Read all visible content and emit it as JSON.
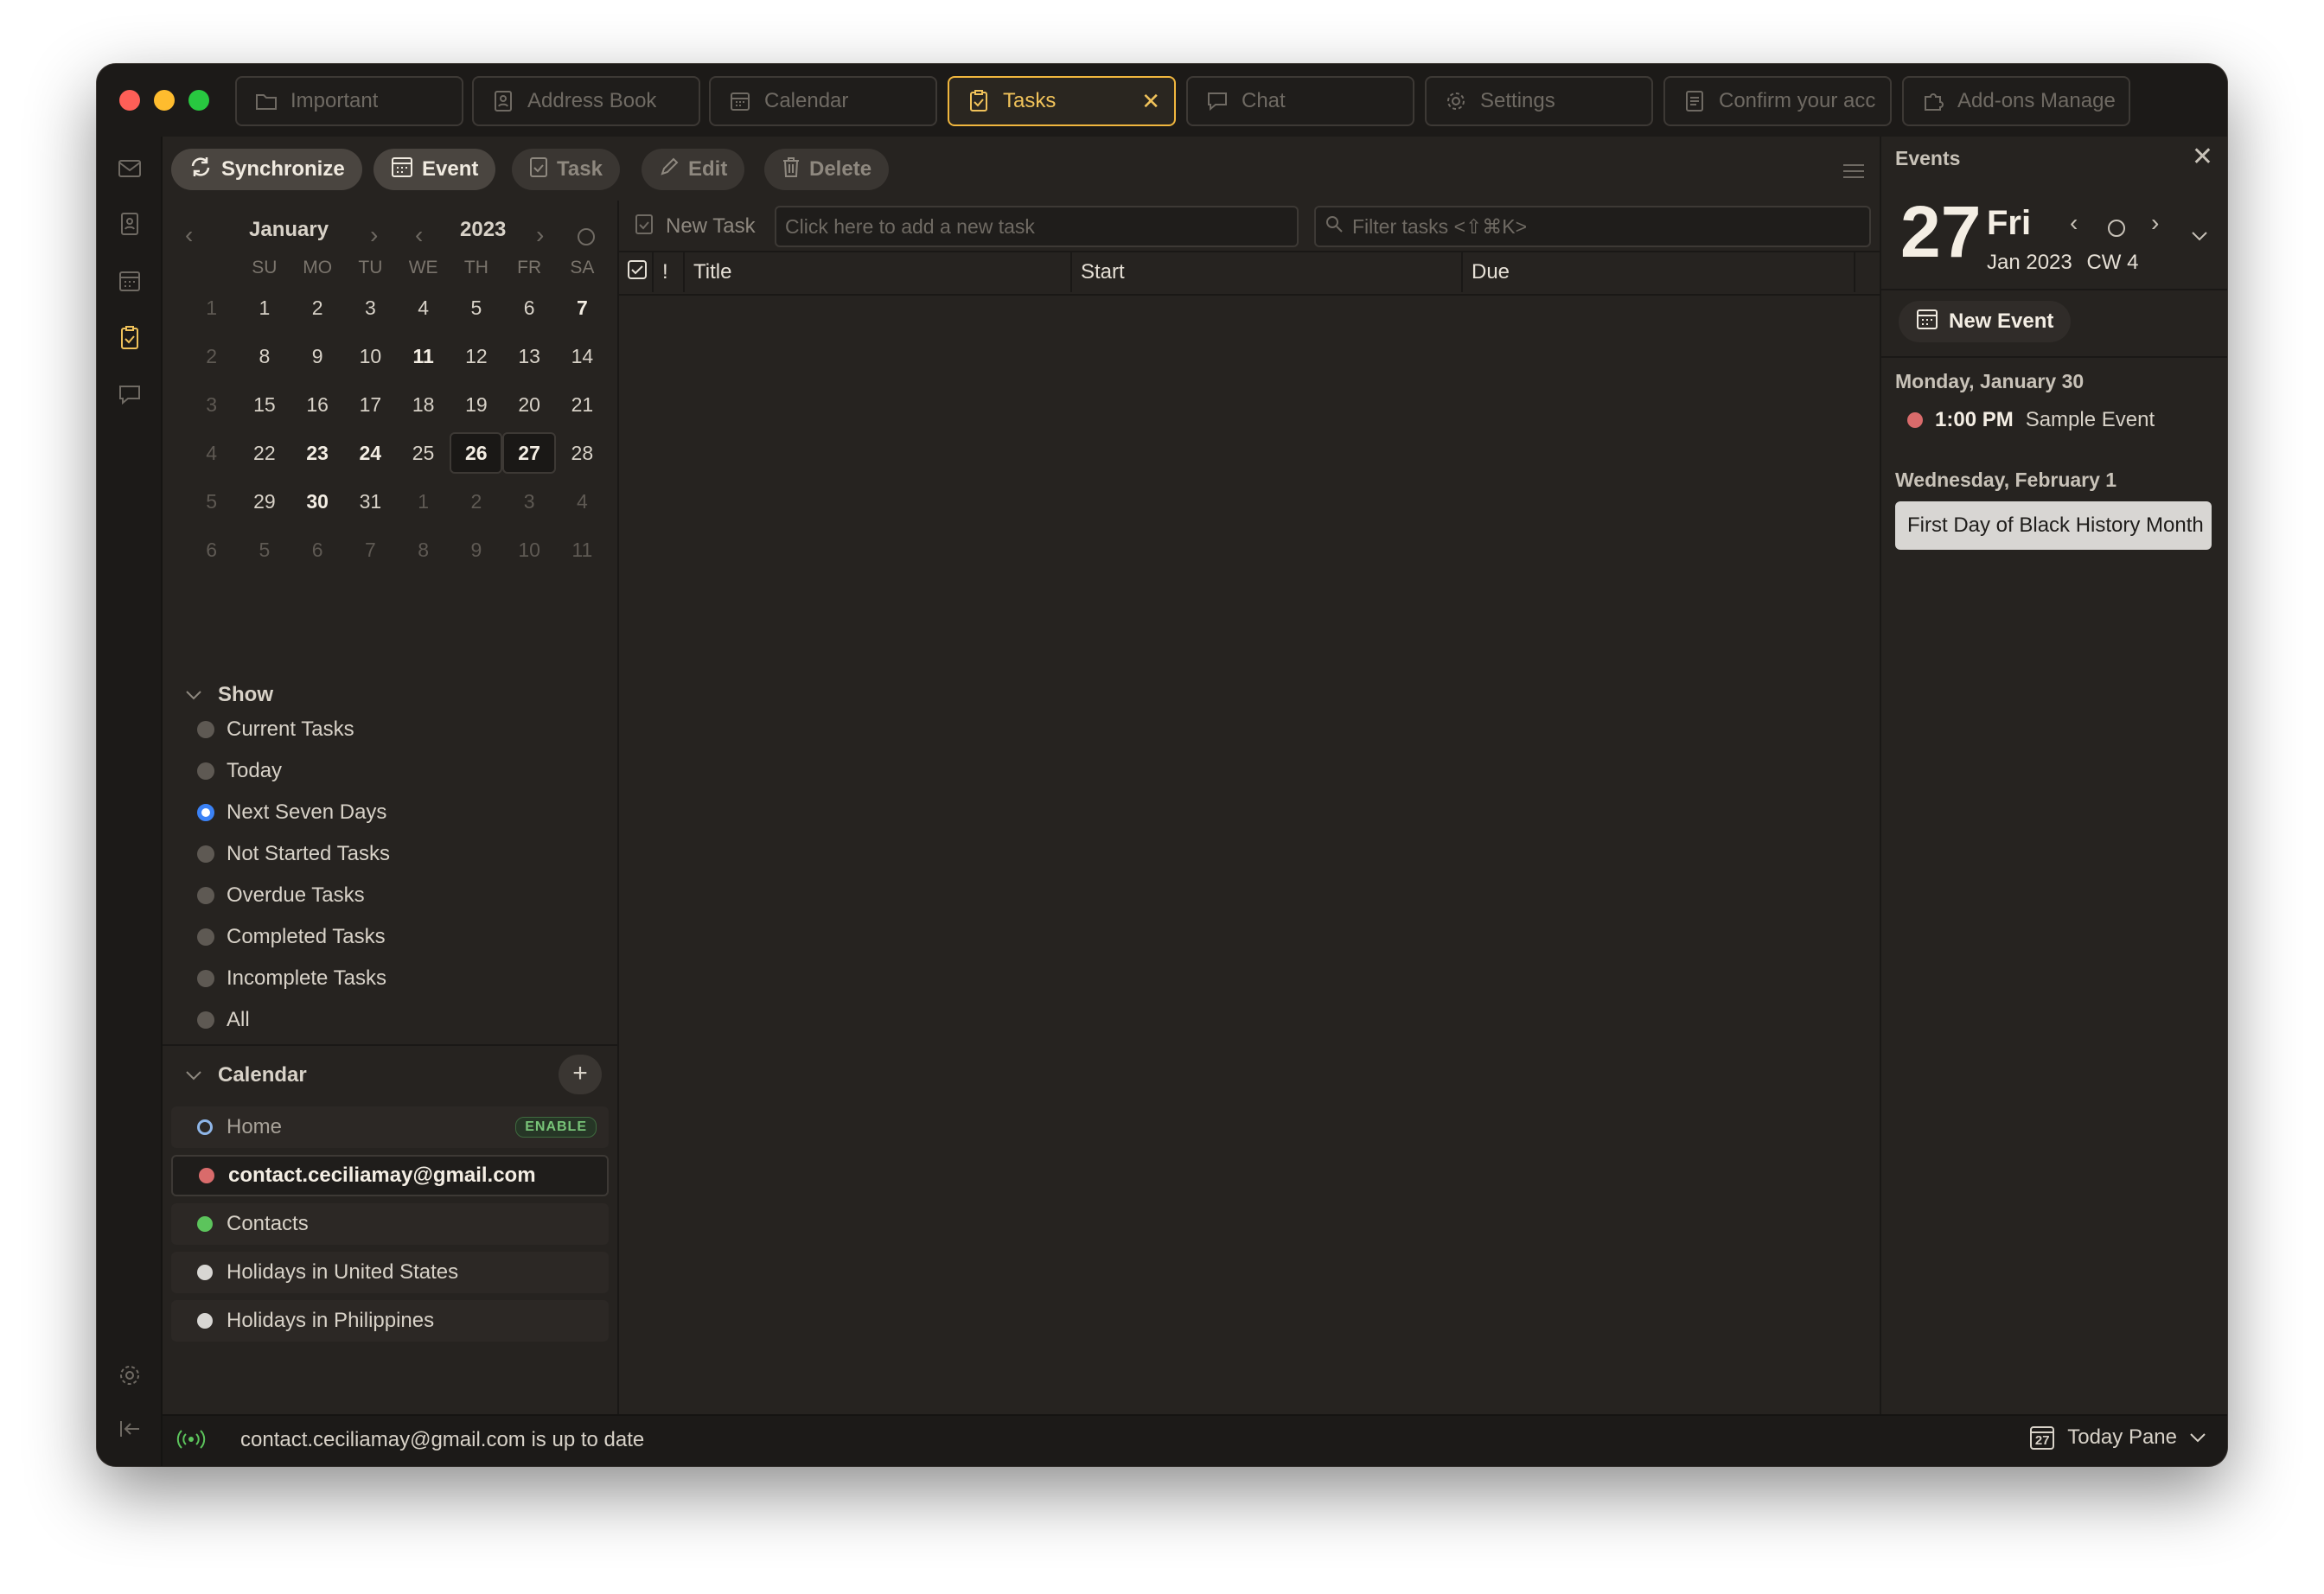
{
  "tabs": [
    {
      "label": "Important",
      "icon": "folder-icon",
      "active": false
    },
    {
      "label": "Address Book",
      "icon": "address-book-icon",
      "active": false
    },
    {
      "label": "Calendar",
      "icon": "calendar-icon",
      "active": false
    },
    {
      "label": "Tasks",
      "icon": "tasks-icon",
      "active": true
    },
    {
      "label": "Chat",
      "icon": "chat-icon",
      "active": false
    },
    {
      "label": "Settings",
      "icon": "gear-icon",
      "active": false
    },
    {
      "label": "Confirm your acc",
      "icon": "document-icon",
      "active": false
    },
    {
      "label": "Add-ons Manage",
      "icon": "puzzle-icon",
      "active": false
    }
  ],
  "toolbar": {
    "synchronize": "Synchronize",
    "event": "Event",
    "task": "Task",
    "edit": "Edit",
    "delete": "Delete"
  },
  "minical": {
    "month": "January",
    "year": "2023",
    "weekdays": [
      "SU",
      "MO",
      "TU",
      "WE",
      "TH",
      "FR",
      "SA"
    ],
    "weeks": [
      {
        "wk": "1",
        "days": [
          "1",
          "2",
          "3",
          "4",
          "5",
          "6",
          "7"
        ]
      },
      {
        "wk": "2",
        "days": [
          "8",
          "9",
          "10",
          "11",
          "12",
          "13",
          "14"
        ]
      },
      {
        "wk": "3",
        "days": [
          "15",
          "16",
          "17",
          "18",
          "19",
          "20",
          "21"
        ]
      },
      {
        "wk": "4",
        "days": [
          "22",
          "23",
          "24",
          "25",
          "26",
          "27",
          "28"
        ]
      },
      {
        "wk": "5",
        "days": [
          "29",
          "30",
          "31",
          "1",
          "2",
          "3",
          "4"
        ]
      },
      {
        "wk": "6",
        "days": [
          "5",
          "6",
          "7",
          "8",
          "9",
          "10",
          "11"
        ]
      }
    ]
  },
  "show": {
    "title": "Show",
    "filters": [
      "Current Tasks",
      "Today",
      "Next Seven Days",
      "Not Started Tasks",
      "Overdue Tasks",
      "Completed Tasks",
      "Incomplete Tasks",
      "All"
    ],
    "selected": "Next Seven Days"
  },
  "calendars": {
    "title": "Calendar",
    "add": "+",
    "items": [
      {
        "name": "Home",
        "color": "#8fb6e8",
        "badge": "ENABLE"
      },
      {
        "name": "contact.ceciliamay@gmail.com",
        "color": "#d96b6b"
      },
      {
        "name": "Contacts",
        "color": "#5cc45c"
      },
      {
        "name": "Holidays in United States",
        "color": "#d8d6d3"
      },
      {
        "name": "Holidays in Philippines",
        "color": "#d8d6d3"
      }
    ]
  },
  "tasks": {
    "new_task_label": "New Task",
    "new_task_placeholder": "Click here to add a new task",
    "filter_placeholder": "Filter tasks <⇧⌘K>",
    "columns": {
      "priority": "!",
      "title": "Title",
      "start": "Start",
      "due": "Due"
    }
  },
  "events_pane": {
    "title": "Events",
    "day_number": "27",
    "day_name": "Fri",
    "month_year": "Jan 2023",
    "week": "CW 4",
    "new_event": "New Event",
    "groups": [
      {
        "date": "Monday, January 30",
        "time": "1:00 PM",
        "event": "Sample Event",
        "color": "#d96b6b"
      },
      {
        "date": "Wednesday, February 1",
        "event": "First Day of Black History Month"
      }
    ]
  },
  "status": {
    "message": "contact.ceciliamay@gmail.com is up to date",
    "today_pane": "Today Pane",
    "today_icon_day": "27"
  }
}
